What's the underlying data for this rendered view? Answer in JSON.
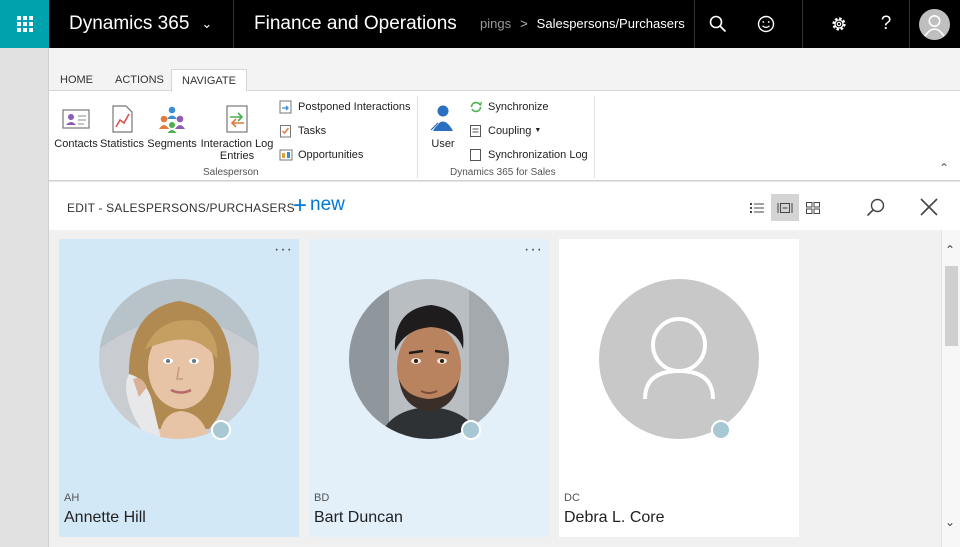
{
  "topbar": {
    "app_name": "Dynamics 365",
    "module": "Finance and Operations",
    "breadcrumb_faded": "pings",
    "breadcrumb_current": "Salespersons/Purchasers",
    "icons": [
      "waffle-icon",
      "search-icon",
      "smiley-icon",
      "gear-icon",
      "help-icon",
      "user-icon"
    ]
  },
  "ribbon": {
    "tabs": [
      "HOME",
      "ACTIONS",
      "NAVIGATE"
    ],
    "active_tab": "NAVIGATE",
    "salesperson_group": {
      "label": "Salesperson",
      "big_buttons": [
        "Contacts",
        "Statistics",
        "Segments",
        "Interaction Log Entries"
      ],
      "small_buttons": [
        "Postponed Interactions",
        "Tasks",
        "Opportunities"
      ]
    },
    "sales_group": {
      "label": "Dynamics 365 for Sales",
      "big_buttons": [
        "User"
      ],
      "small_buttons": [
        "Synchronize",
        "Coupling",
        "Synchronization Log"
      ]
    }
  },
  "content": {
    "caption": "EDIT - SALESPERSONS/PURCHASERS",
    "new_label": "new",
    "more_label": "···"
  },
  "cards": [
    {
      "initials": "AH",
      "name": "Annette Hill",
      "selected": true
    },
    {
      "initials": "BD",
      "name": "Bart Duncan",
      "selected": false
    },
    {
      "initials": "DC",
      "name": "Debra L. Core",
      "selected": false
    }
  ],
  "colors": {
    "accent": "#00a2ad",
    "link": "#0078d7",
    "card_selected": "#d3e8f7",
    "card_hover": "#e3f0fa"
  }
}
